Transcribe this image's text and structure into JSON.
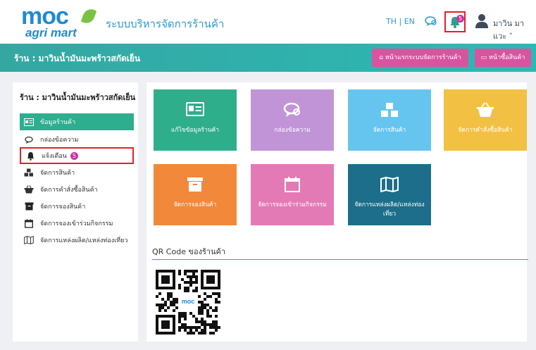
{
  "header": {
    "logo_text": "moc",
    "logo_sub": "agri mart",
    "app_title": "ระบบบริหารจัดการร้านค้า",
    "lang": "TH | EN",
    "notification_count": "5",
    "user_name": "มาวิน มาแวะ ˅",
    "icons": [
      "chat-icon",
      "bell-icon",
      "user-icon"
    ]
  },
  "shopbar": {
    "title": "ร้าน : มาวินน้ำมันมะพร้าวสกัดเย็น",
    "home_button": "หน้าแรกระบบจัดการร้านค้า",
    "buy_button": "หน้าซื้อสินค้า"
  },
  "sidebar": {
    "title": "ร้าน : มาวินน้ำมันมะพร้าวสกัดเย็น",
    "items": [
      {
        "label": "ข้อมูลร้านค้า",
        "icon": "id-card-icon"
      },
      {
        "label": "กล่องข้อความ",
        "icon": "chat-icon"
      },
      {
        "label": "แจ้งเตือน",
        "icon": "bell-icon",
        "badge": "5"
      },
      {
        "label": "จัดการสินค้า",
        "icon": "cubes-icon"
      },
      {
        "label": "จัดการคำสั่งซื้อสินค้า",
        "icon": "basket-icon"
      },
      {
        "label": "จัดการจองสินค้า",
        "icon": "archive-icon"
      },
      {
        "label": "จัดการจองเข้าร่วมกิจกรรม",
        "icon": "calendar-icon"
      },
      {
        "label": "จัดการแหล่งผลิต/แหล่งท่องเที่ยว",
        "icon": "map-icon"
      }
    ]
  },
  "tiles": [
    {
      "label": "แก้ไขข้อมูลร้านค้า",
      "icon": "id-card-icon",
      "color": "#2fae8c"
    },
    {
      "label": "กล่องข้อความ",
      "icon": "chat-icon",
      "color": "#c194d7"
    },
    {
      "label": "จัดการสินค้า",
      "icon": "cubes-icon",
      "color": "#66c5ef"
    },
    {
      "label": "จัดการคำสั่งซื้อสินค้า",
      "icon": "basket-icon",
      "color": "#f2c143"
    },
    {
      "label": "จัดการจองสินค้า",
      "icon": "archive-icon",
      "color": "#f2883a"
    },
    {
      "label": "จัดการจองเข้าร่วมกิจกรรม",
      "icon": "calendar-icon",
      "color": "#e37ab5"
    },
    {
      "label": "จัดการแหล่งผลิต/แหล่งท่องเที่ยว",
      "icon": "map-icon",
      "color": "#1c6e8a"
    }
  ],
  "qr": {
    "title": "QR Code ของร้านค้า",
    "center_logo": "moc"
  },
  "colors": {
    "accent_teal": "#2cae8f",
    "button_pink": "#d8549f",
    "highlight_red": "#e41f2b"
  }
}
